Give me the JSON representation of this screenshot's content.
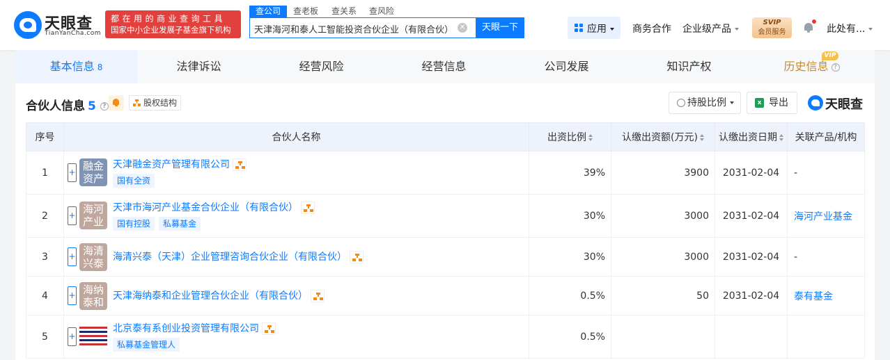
{
  "header": {
    "logo_text": "天眼查",
    "logo_sub": "TianYanCha.com",
    "ad_line1": "都在用的商业查询工具",
    "ad_line2": "国家中小企业发展子基金旗下机构",
    "search_tabs": [
      "查公司",
      "查老板",
      "查关系",
      "查风险"
    ],
    "search_value": "天津海河和泰人工智能投资合伙企业（有限合伙）",
    "search_button": "天眼一下",
    "apps_label": "应用",
    "nav_business": "商务合作",
    "nav_enterprise": "企业级产品",
    "svip_top": "SVIP",
    "svip_bottom": "会员服务",
    "user_name": "此处有..."
  },
  "main_tabs": [
    {
      "label": "基本信息",
      "count": "8"
    },
    {
      "label": "法律诉讼"
    },
    {
      "label": "经营风险"
    },
    {
      "label": "经营信息"
    },
    {
      "label": "公司发展"
    },
    {
      "label": "知识产权"
    },
    {
      "label": "历史信息",
      "badge": "VIP"
    }
  ],
  "section": {
    "title": "合伙人信息",
    "count": "5",
    "equity_link": "股权结构",
    "hold_ratio_button": "持股比例",
    "export_button": "导出",
    "brand": "天眼查"
  },
  "table": {
    "headers": [
      "序号",
      "合伙人名称",
      "出资比例",
      "认缴出资额(万元)",
      "认缴出资日期",
      "关联产品/机构"
    ],
    "rows": [
      {
        "idx": "1",
        "logo": "融金资产",
        "logo_color": "#7f93b5",
        "name": "天津融金资产管理有限公司",
        "tags": [
          "国有全资"
        ],
        "ratio": "39%",
        "amount": "3900",
        "date": "2031-02-04",
        "related": "-"
      },
      {
        "idx": "2",
        "logo": "海河产业",
        "logo_color": "#bfa79e",
        "name": "天津市海河产业基金合伙企业（有限合伙）",
        "tags": [
          "国有控股",
          "私募基金"
        ],
        "ratio": "30%",
        "amount": "3000",
        "date": "2031-02-04",
        "related": "海河产业基金"
      },
      {
        "idx": "3",
        "logo": "海清兴泰",
        "logo_color": "#bfa79e",
        "name": "海清兴泰（天津）企业管理咨询合伙企业（有限合伙）",
        "tags": [],
        "ratio": "30%",
        "amount": "3000",
        "date": "2031-02-04",
        "related": "-"
      },
      {
        "idx": "4",
        "logo": "海纳泰和",
        "logo_color": "#bfa79e",
        "name": "天津海纳泰和企业管理合伙企业（有限合伙）",
        "tags": [],
        "ratio": "0.5%",
        "amount": "50",
        "date": "2031-02-04",
        "related": "泰有基金"
      },
      {
        "idx": "5",
        "logo": "",
        "logo_color": "",
        "name": "北京泰有系创业投资管理有限公司",
        "tags": [
          "私募基金管理人"
        ],
        "ratio": "0.5%",
        "amount": "",
        "date": "",
        "related": ""
      }
    ]
  },
  "icons": {
    "search_clear": "clear-icon",
    "apps": "grid-icon",
    "notification": "bell-icon",
    "help": "question-icon",
    "equity": "org-tree-icon",
    "export": "excel-icon",
    "hold_ratio": "filter-icon"
  },
  "colors": {
    "brand_blue": "#0d7bff",
    "ad_red": "#e1403d",
    "history_gold": "#c98a26",
    "tree_orange": "#f28a16"
  }
}
